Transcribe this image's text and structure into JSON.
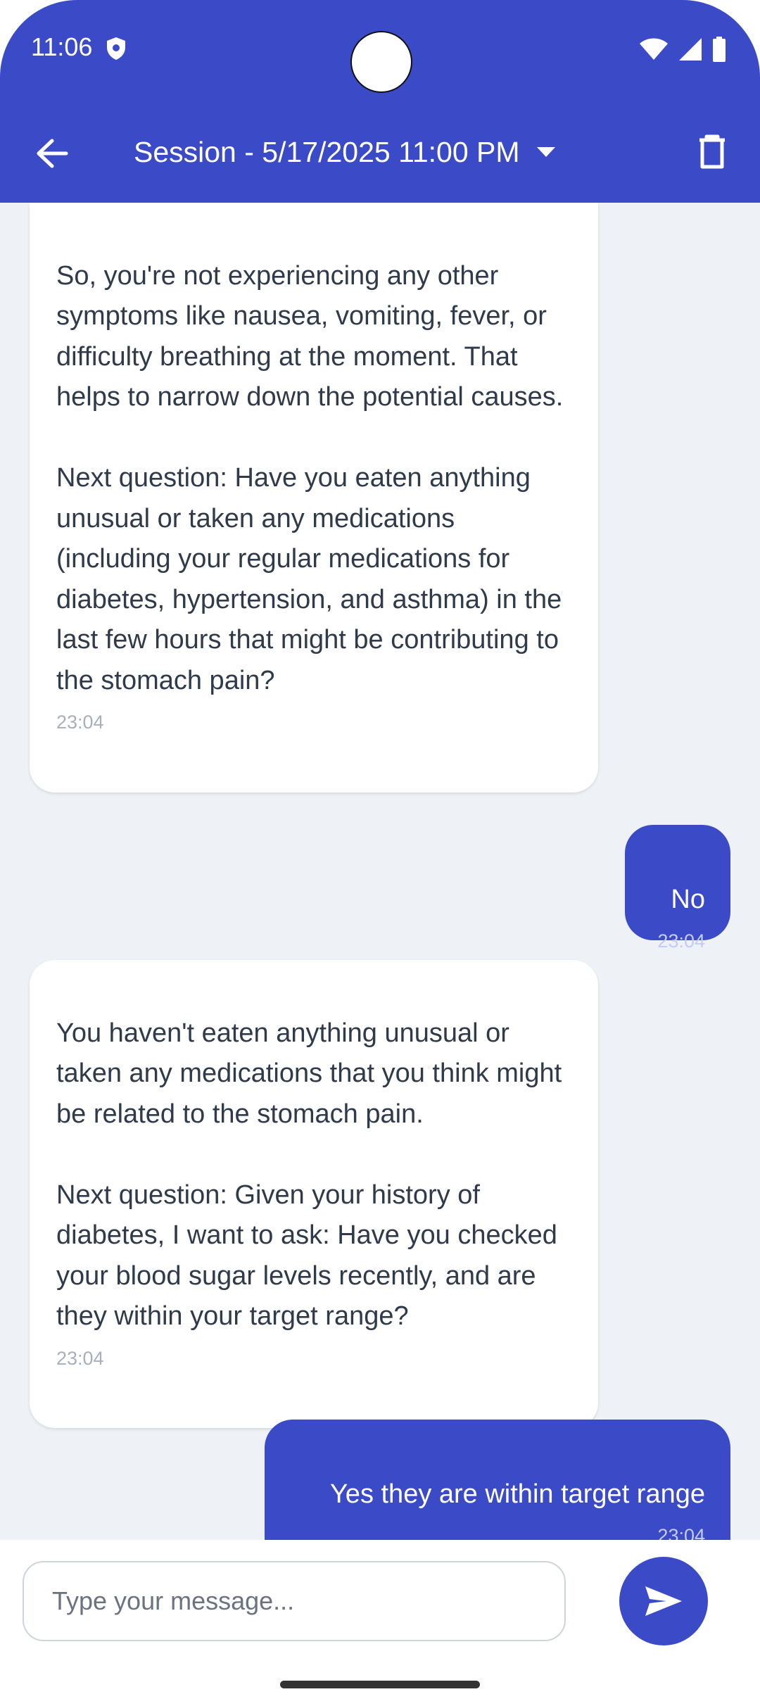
{
  "status_bar": {
    "time": "11:06"
  },
  "header": {
    "title": "Session - 5/17/2025 11:00 PM"
  },
  "messages": [
    {
      "role": "bot",
      "text": "So, you're not experiencing any other symptoms like nausea, vomiting, fever, or difficulty breathing at the moment. That helps to narrow down the potential causes.\n\nNext question: Have you eaten anything unusual or taken any medications (including your regular medications for diabetes, hypertension, and asthma) in the last few hours that might be contributing to the stomach pain?",
      "time": "23:04"
    },
    {
      "role": "user",
      "text": "No",
      "time": "23:04"
    },
    {
      "role": "bot",
      "text": "You haven't eaten anything unusual or taken any medications that you think might be related to the stomach pain.\n\nNext question: Given your history of diabetes, I want to ask: Have you checked your blood sugar levels recently, and are they within your target range?",
      "time": "23:04"
    },
    {
      "role": "user",
      "text": "Yes they are within target range",
      "time": "23:04"
    }
  ],
  "composer": {
    "placeholder": "Type your message..."
  },
  "colors": {
    "primary": "#3b4bc8",
    "background": "#eef1f6",
    "bot_bubble": "#ffffff"
  }
}
